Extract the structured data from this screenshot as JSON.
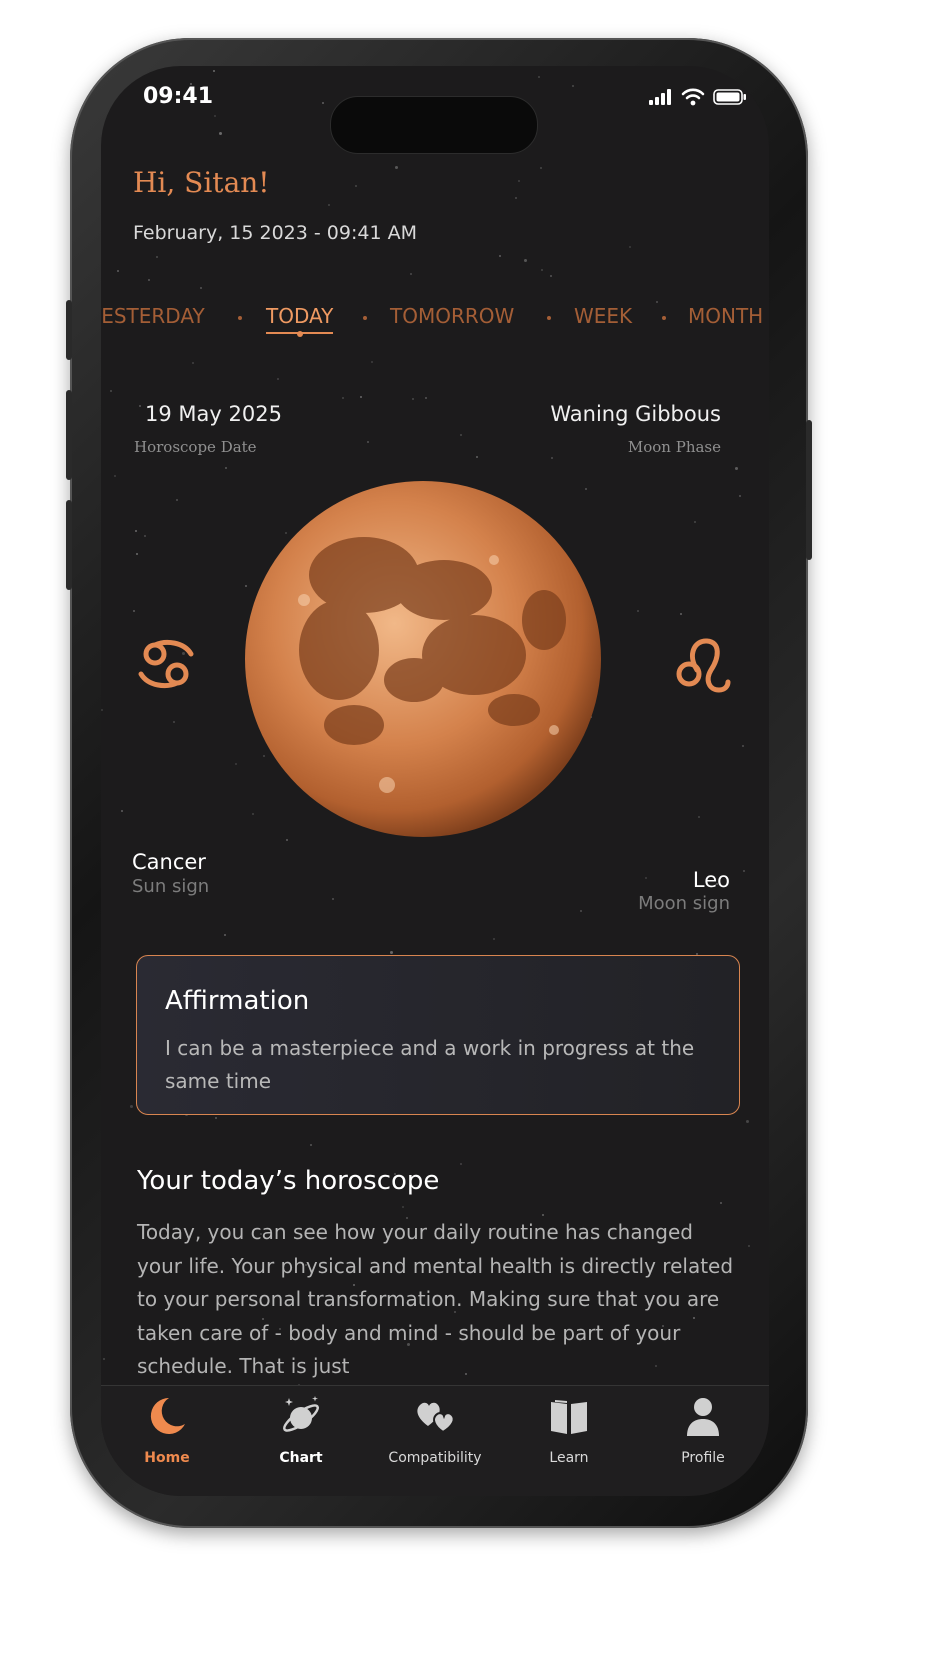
{
  "status_bar": {
    "time": "09:41"
  },
  "header": {
    "greeting": "Hi, Sitan!",
    "datetime": "February, 15 2023 - 09:41 AM"
  },
  "period_tabs": [
    {
      "label": "YESTERDAY"
    },
    {
      "label": "TODAY",
      "active": true
    },
    {
      "label": "TOMORROW"
    },
    {
      "label": "WEEK"
    },
    {
      "label": "MONTH"
    }
  ],
  "horoscope_date": {
    "value": "19 May 2025",
    "label": "Horoscope Date"
  },
  "moon_phase": {
    "value": "Waning Gibbous",
    "label": "Moon Phase"
  },
  "sun_sign": {
    "name": "Cancer",
    "label": "Sun sign",
    "icon": "cancer-icon"
  },
  "moon_sign": {
    "name": "Leo",
    "label": "Moon sign",
    "icon": "leo-icon"
  },
  "affirmation": {
    "title": "Affirmation",
    "text": "I can be a masterpiece and a work in progress at the same time"
  },
  "horoscope": {
    "title": "Your today’s horoscope",
    "text": "Today, you can see how your daily routine has changed your life. Your physical and mental health is directly related to your personal transformation. Making sure that you are taken care of - body and mind - should be part of your schedule. That is just"
  },
  "tab_bar": [
    {
      "label": "Home",
      "icon": "moon-icon",
      "active": true
    },
    {
      "label": "Chart",
      "icon": "planet-icon"
    },
    {
      "label": "Compatibility",
      "icon": "hearts-icon"
    },
    {
      "label": "Learn",
      "icon": "book-icon"
    },
    {
      "label": "Profile",
      "icon": "person-icon"
    }
  ],
  "colors": {
    "accent": "#e38a53",
    "background": "#1c1b1c",
    "moon": "#c26a36"
  }
}
